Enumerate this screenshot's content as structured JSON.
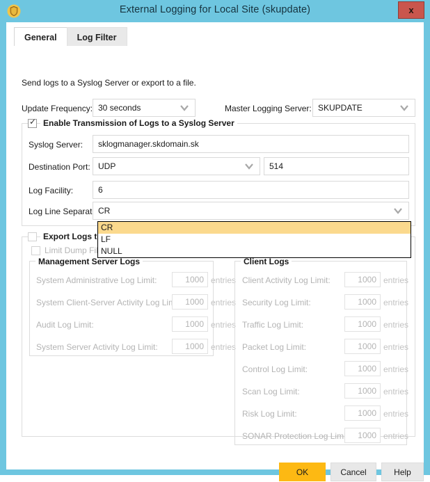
{
  "window": {
    "title": "External Logging for Local Site (skupdate)",
    "icon": "shield-icon",
    "close_label": "x",
    "titlebar_color": "#6ec6e0",
    "close_color": "#c9564d"
  },
  "tabs": [
    {
      "label": "General",
      "active": true
    },
    {
      "label": "Log Filter",
      "active": false
    }
  ],
  "intro": "Send logs to a Syslog Server or export to a file.",
  "top_row": {
    "update_frequency_label": "Update Frequency:",
    "update_frequency_value": "30 seconds",
    "master_logging_server_label": "Master Logging Server:",
    "master_logging_server_value": "SKUPDATE"
  },
  "syslog_group": {
    "title": "Enable Transmission of Logs to a Syslog Server",
    "checked": true,
    "rows": {
      "syslog_server_label": "Syslog Server:",
      "syslog_server_value": "sklogmanager.skdomain.sk",
      "destination_port_label": "Destination Port:",
      "destination_port_protocol": "UDP",
      "destination_port_number": "514",
      "log_facility_label": "Log Facility:",
      "log_facility_value": "6",
      "log_line_separator_label": "Log Line Separator:",
      "log_line_separator_value": "CR"
    }
  },
  "separator_dropdown": {
    "open": true,
    "options": [
      "CR",
      "LF",
      "NULL"
    ],
    "selected": "CR",
    "highlight_color": "#fbd98d"
  },
  "export_group": {
    "title": "Export Logs to",
    "checked": false,
    "limit_dump_label": "Limit Dump File",
    "limit_dump_checked": false,
    "management_server_logs": {
      "title": "Management Server Logs",
      "unit": "entries",
      "rows": [
        {
          "label": "System Administrative Log Limit:",
          "value": "1000"
        },
        {
          "label": "System Client-Server Activity Log Limit:",
          "value": "1000"
        },
        {
          "label": "Audit Log Limit:",
          "value": "1000"
        },
        {
          "label": "System Server Activity Log Limit:",
          "value": "1000"
        }
      ]
    },
    "client_logs": {
      "title": "Client Logs",
      "unit": "entries",
      "rows": [
        {
          "label": "Client Activity Log Limit:",
          "value": "1000"
        },
        {
          "label": "Security Log Limit:",
          "value": "1000"
        },
        {
          "label": "Traffic Log Limit:",
          "value": "1000"
        },
        {
          "label": "Packet Log Limit:",
          "value": "1000"
        },
        {
          "label": "Control Log Limit:",
          "value": "1000"
        },
        {
          "label": "Scan Log Limit:",
          "value": "1000"
        },
        {
          "label": "Risk Log Limit:",
          "value": "1000"
        },
        {
          "label": "SONAR Protection Log Limit:",
          "value": "1000"
        }
      ]
    }
  },
  "footer": {
    "ok_label": "OK",
    "cancel_label": "Cancel",
    "help_label": "Help",
    "ok_color": "#fdb913"
  }
}
